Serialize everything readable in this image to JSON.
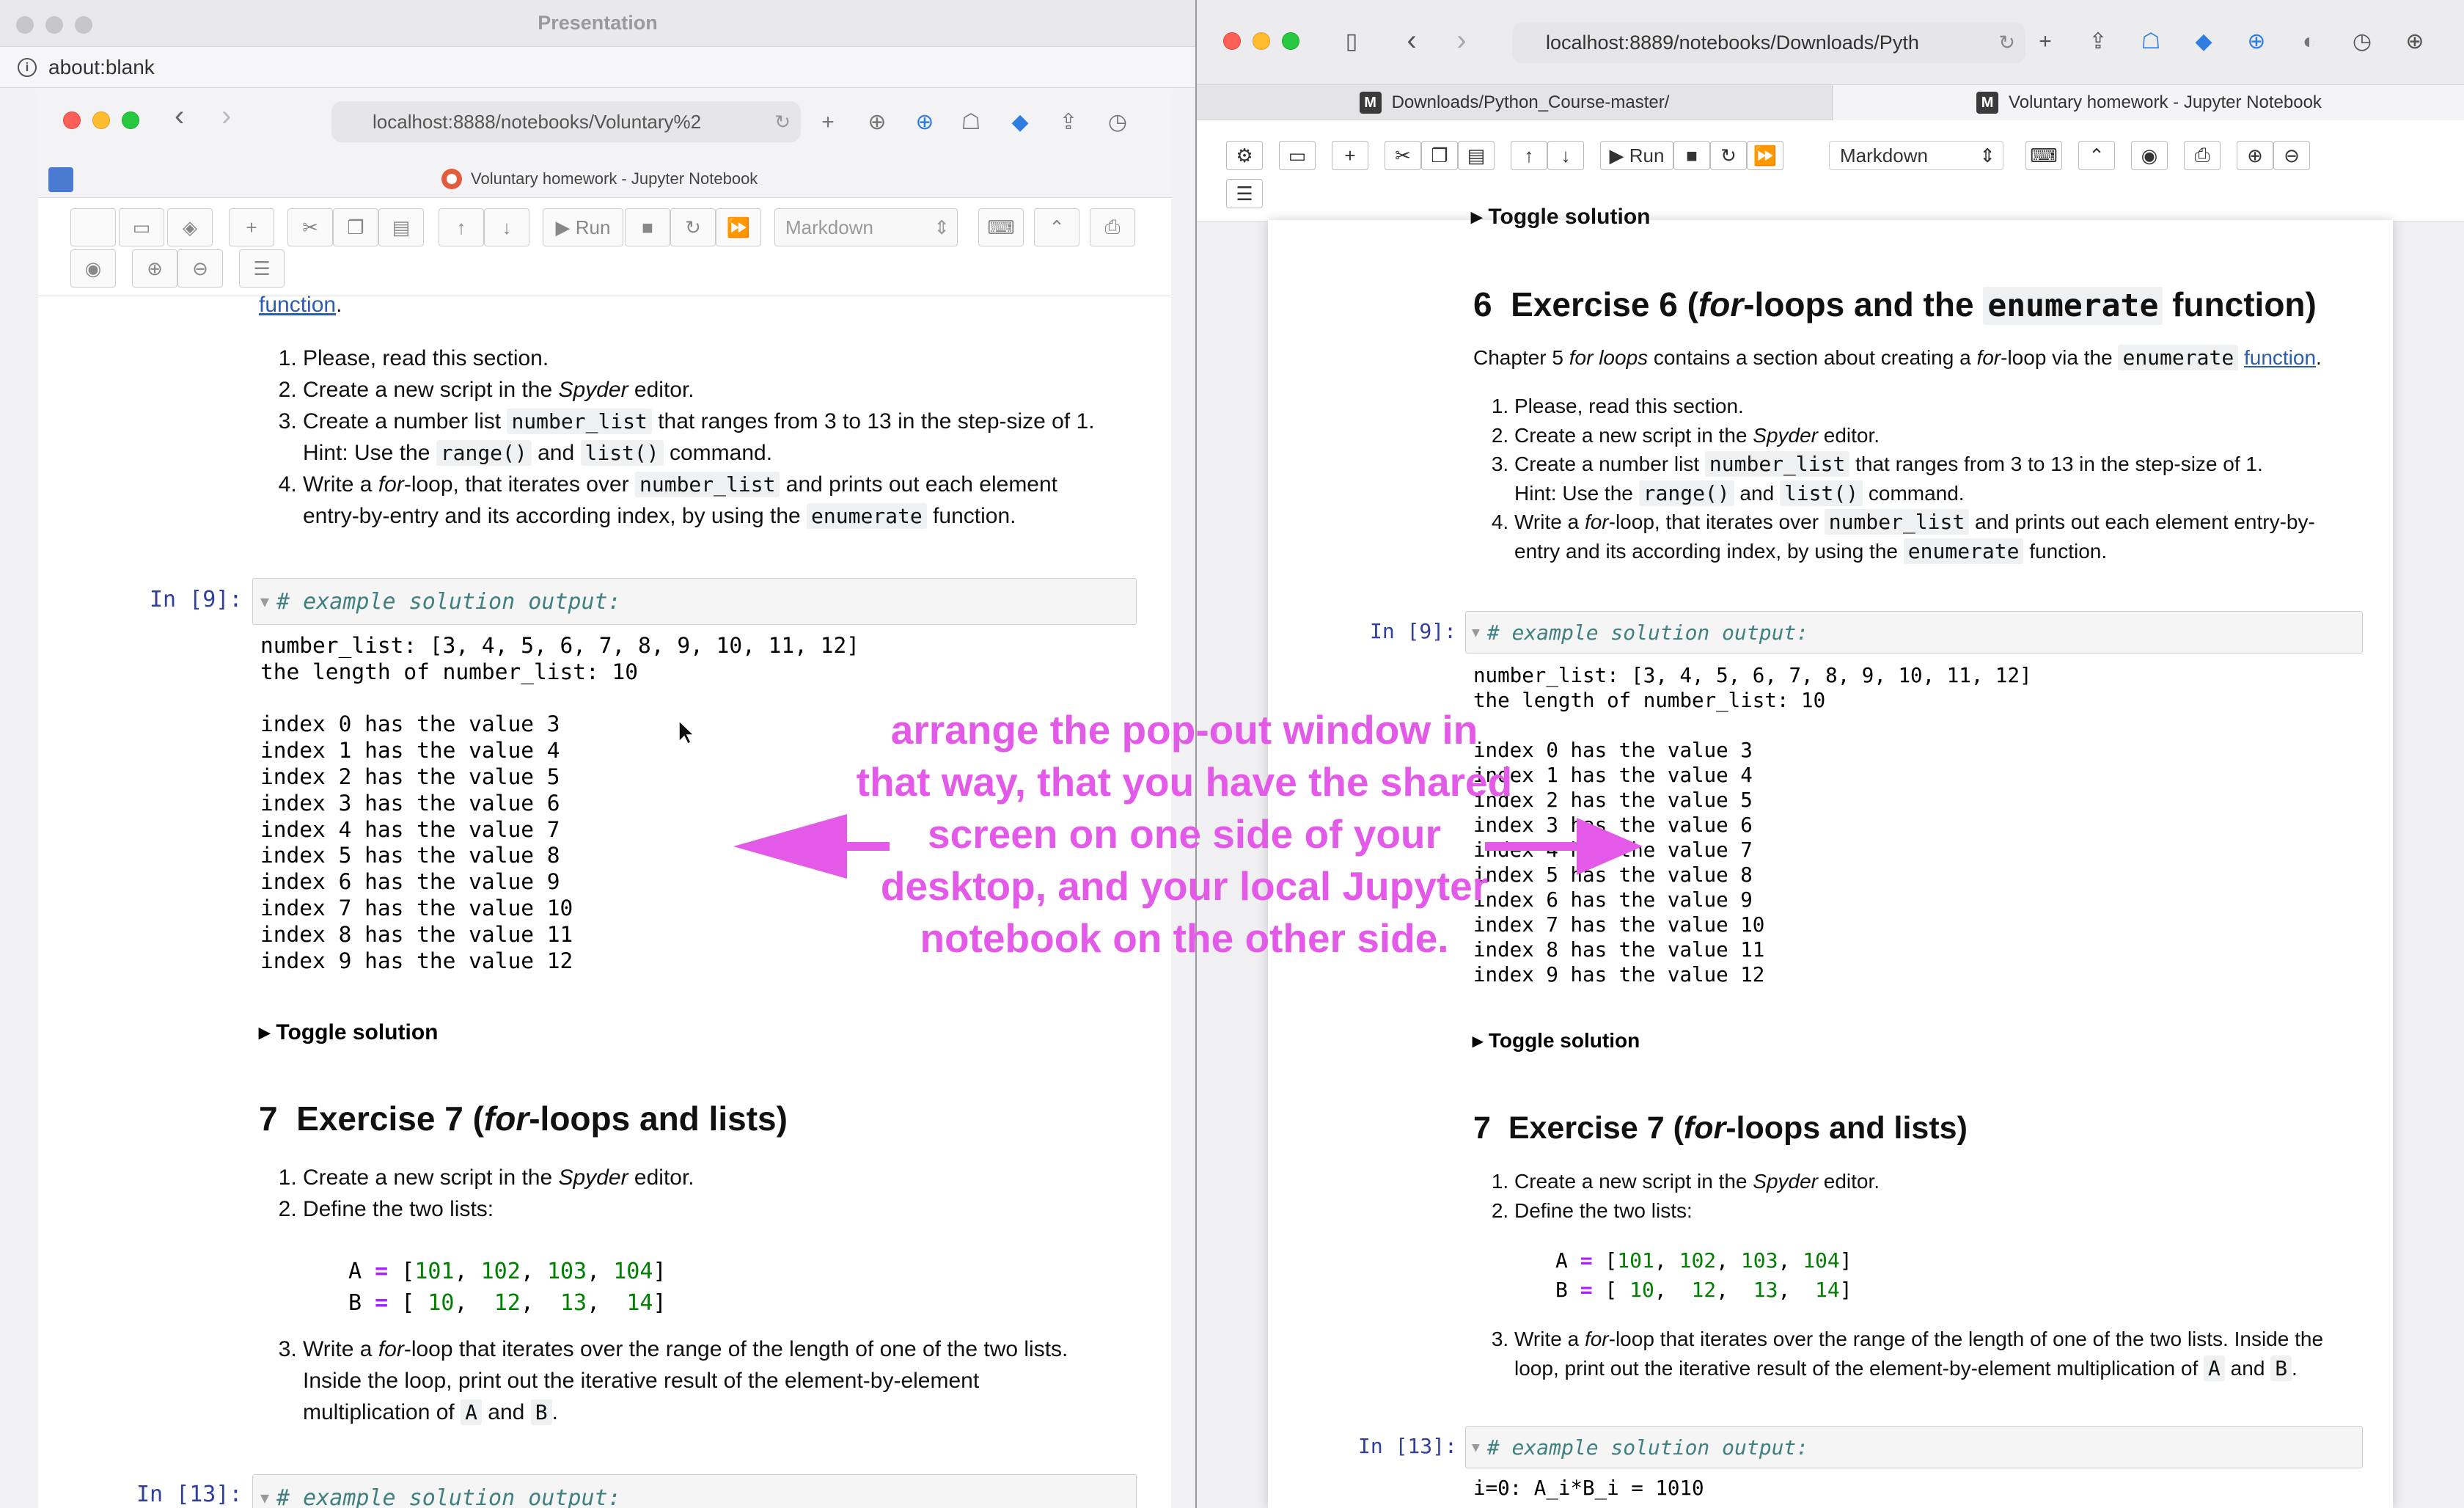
{
  "left_window": {
    "title": "Presentation",
    "url": "about:blank",
    "inner": {
      "url": "localhost:8888/notebooks/Voluntary%2",
      "tab_title": "Voluntary homework - Jupyter Notebook",
      "toolbar": {
        "run": "Run",
        "cell_type": "Markdown"
      },
      "top_link": "function",
      "steps": [
        "Please, read this section.",
        "Create a new script in the Spyder editor.",
        "Create a number list number_list that ranges from 3 to 13 in the step-size of 1.",
        "Hint: Use the range() and list() command.",
        "Write a for-loop, that iterates over number_list and prints out each element",
        "entry-by-entry and its according index, by using the enumerate function."
      ],
      "cell1": {
        "prompt": "In [9]:",
        "comment": "# example solution output:",
        "output": "number_list: [3, 4, 5, 6, 7, 8, 9, 10, 11, 12]\nthe length of number_list: 10\n\nindex 0 has the value 3\nindex 1 has the value 4\nindex 2 has the value 5\nindex 3 has the value 6\nindex 4 has the value 7\nindex 5 has the value 8\nindex 6 has the value 9\nindex 7 has the value 10\nindex 8 has the value 11\nindex 9 has the value 12"
      },
      "toggle": "Toggle solution",
      "ex7": {
        "heading_num": "7",
        "heading_pre": "Exercise 7 (",
        "heading_em": "for",
        "heading_post": "-loops and lists)",
        "step1": "Create a new script in the Spyder editor.",
        "step2": "Define the two lists:",
        "lineA": "A = [101, 102, 103, 104]",
        "lineB": "B = [ 10,  12,  13,  14]",
        "step3a": "Write a for-loop that iterates over the range of the length of one of the two lists.",
        "step3b": "Inside the loop, print out the iterative result of the element-by-element",
        "step3c": "multiplication of A and B."
      },
      "cell2": {
        "prompt": "In [13]:",
        "comment": "# example solution output:"
      }
    }
  },
  "right_window": {
    "url": "localhost:8889/notebooks/Downloads/Pyth",
    "tabs": [
      {
        "label": "Downloads/Python_Course-master/"
      },
      {
        "label": "Voluntary homework - Jupyter Notebook"
      }
    ],
    "toolbar": {
      "run": "Run",
      "cell_type": "Markdown"
    },
    "partial_toggle": "Toggle solution",
    "ex6": {
      "heading_num": "6",
      "heading_pre": "Exercise 6 (",
      "heading_em": "for",
      "heading_mid": "-loops and the ",
      "heading_code": "enumerate",
      "heading_post": " function)",
      "intro_pre": "Chapter 5 ",
      "intro_em": "for loops",
      "intro_mid": " contains a section about creating a ",
      "intro_em2": "for",
      "intro_mid2": "-loop via the ",
      "intro_code": "enumerate",
      "intro_link": "function",
      "steps": [
        "Please, read this section.",
        "Create a new script in the Spyder editor.",
        "Create a number list number_list that ranges from 3 to 13 in the step-size of 1.",
        "Hint: Use the range() and list() command.",
        "Write a for-loop, that iterates over number_list and prints out each element entry-by-",
        "entry and its according index, by using the enumerate function."
      ]
    },
    "cell1": {
      "prompt": "In [9]:",
      "comment": "# example solution output:",
      "output": "number_list: [3, 4, 5, 6, 7, 8, 9, 10, 11, 12]\nthe length of number_list: 10\n\nindex 0 has the value 3\nindex 1 has the value 4\nindex 2 has the value 5\nindex 3 has the value 6\nindex 4 has the value 7\nindex 5 has the value 8\nindex 6 has the value 9\nindex 7 has the value 10\nindex 8 has the value 11\nindex 9 has the value 12"
    },
    "toggle": "Toggle solution",
    "ex7": {
      "heading_num": "7",
      "heading_pre": "Exercise 7 (",
      "heading_em": "for",
      "heading_post": "-loops and lists)",
      "step1": "Create a new script in the Spyder editor.",
      "step2": "Define the two lists:",
      "lineA": "A = [101, 102, 103, 104]",
      "lineB": "B = [ 10,  12,  13,  14]",
      "step3a": "Write a for-loop that iterates over the range of the length of one of the two lists. Inside the",
      "step3b": "loop, print out the iterative result of the element-by-element multiplication of A and B."
    },
    "cell2": {
      "prompt": "In [13]:",
      "comment": "# example solution output:",
      "output": "i=0: A_i*B_i = 1010"
    }
  },
  "annotation": {
    "text": "arrange the pop-out window in that way,  that you have the shared screen on one side of your desktop, and your local Jupyter notebook on the other side.",
    "color": "#e35ae8"
  }
}
